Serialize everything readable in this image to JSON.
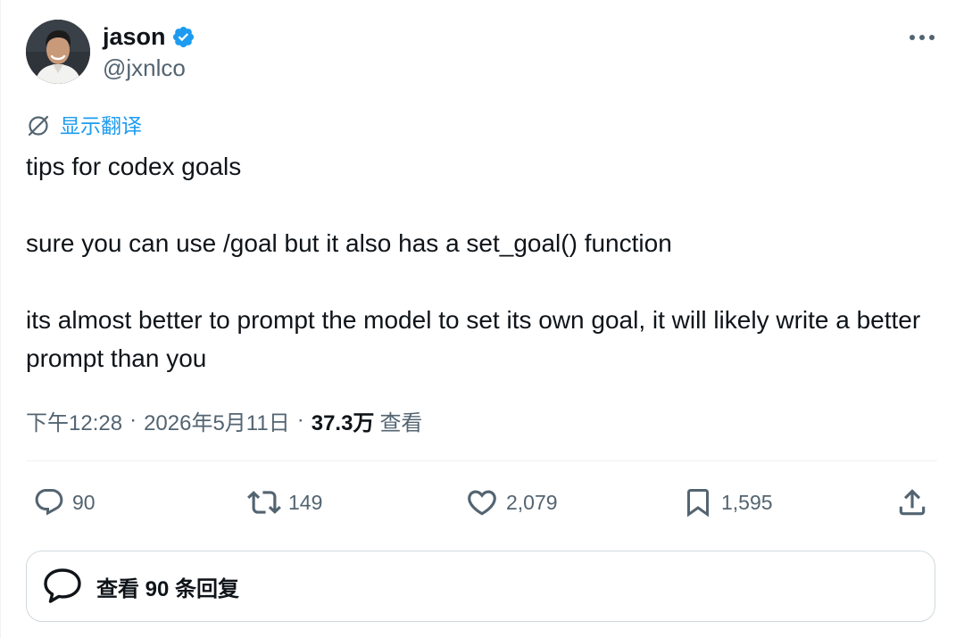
{
  "author": {
    "display_name": "jason",
    "handle": "@jxnlco",
    "verified": true,
    "verified_color": "#1d9bf0",
    "avatar_icon": "user-photo-avatar"
  },
  "header": {
    "more_icon": "more-horizontal-icon"
  },
  "translate": {
    "label": "显示翻译",
    "icon": "translate-icon",
    "color": "#1d9bf0"
  },
  "tweet": {
    "paragraphs": [
      "tips for codex goals",
      "sure you can use /goal but it also has a set_goal() function",
      "its almost better to prompt the model to set its own goal, it will likely write a better prompt than you"
    ]
  },
  "meta": {
    "time": "下午12:28",
    "separator": "·",
    "date": "2026年5月11日",
    "views_count": "37.3万",
    "views_label": "查看"
  },
  "actions": {
    "reply": {
      "count": "90",
      "icon": "reply-icon"
    },
    "retweet": {
      "count": "149",
      "icon": "retweet-icon"
    },
    "like": {
      "count": "2,079",
      "icon": "heart-icon"
    },
    "bookmark": {
      "count": "1,595",
      "icon": "bookmark-icon"
    },
    "share": {
      "icon": "share-icon"
    }
  },
  "replies_button": {
    "label": "查看 90 条回复",
    "icon": "replies-bubble-icon"
  },
  "colors": {
    "text_primary": "#0f1419",
    "text_secondary": "#536471",
    "border": "#cfd9de",
    "accent": "#1d9bf0"
  }
}
